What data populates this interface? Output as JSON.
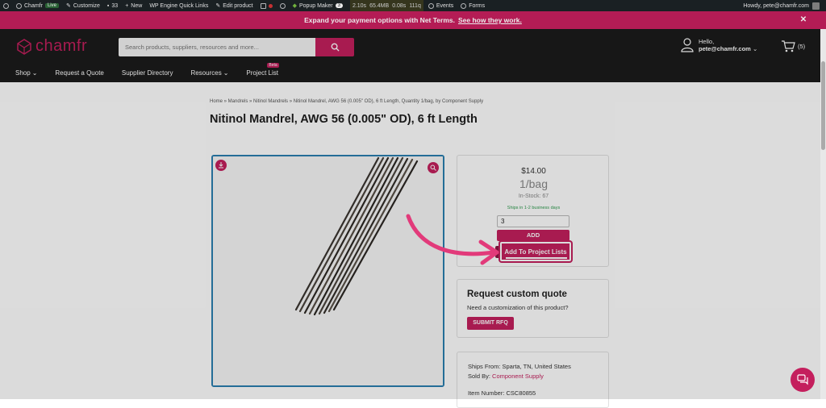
{
  "admin_bar": {
    "site": "Chamfr",
    "live": "Live",
    "customize": "Customize",
    "comments_count": "33",
    "new": "New",
    "quick_links": "WP Engine Quick Links",
    "edit_product": "Edit product",
    "popup_maker": "Popup Maker",
    "popup_count": "3",
    "perf": [
      "2.10s",
      "65.4MB",
      "0.08s",
      "111q"
    ],
    "events": "Events",
    "forms": "Forms",
    "howdy": "Howdy, pete@chamfr.com"
  },
  "promo": {
    "text": "Expand your payment options with Net Terms.",
    "link": "See how they work."
  },
  "header": {
    "logo": "chamfr",
    "search_placeholder": "Search products, suppliers, resources and more...",
    "hello": "Hello,",
    "account": "pete@chamfr.com",
    "cart_count": "(5)"
  },
  "nav": [
    {
      "label": "Shop"
    },
    {
      "label": "Request a Quote"
    },
    {
      "label": "Supplier Directory"
    },
    {
      "label": "Resources"
    },
    {
      "label": "Project List",
      "badge": "Beta"
    }
  ],
  "product": {
    "breadcrumb": "Home » Mandrels » Nitinol Mandrels » Nitinol Mandrel, AWG 56 (0.005\" OD), 6 ft Length, Quantity 1/bag, by Component Supply",
    "title": "Nitinol Mandrel, AWG 56 (0.005\" OD), 6 ft Length",
    "price": "$14.00",
    "unit": "1/bag",
    "stock": "In-Stock: 67",
    "ships": "Ships in 1-2 business days",
    "qty": "3",
    "add_label": "ADD",
    "project_label": "Add To Project Lists"
  },
  "rfq": {
    "title": "Request custom quote",
    "subtitle": "Need a customization of this product?",
    "button": "SUBMIT RFQ"
  },
  "info": {
    "ships_from": "Ships From: Sparta, TN, United States",
    "sold_by_label": "Sold By:",
    "sold_by": "Component Supply",
    "item_number": "Item Number: CSC80855"
  },
  "colors": {
    "brand": "#c41f5d",
    "header_bg": "#1b1b1b",
    "admin_bg": "#1d2327"
  }
}
